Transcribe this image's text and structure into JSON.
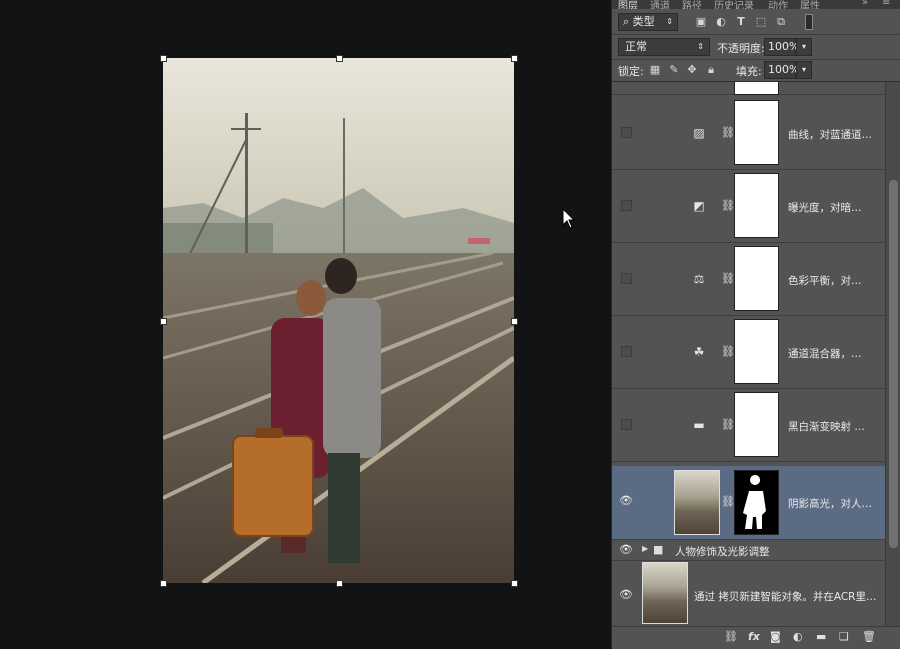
{
  "tabs": [
    "图层",
    "通道",
    "路径",
    "历史记录",
    "动作",
    "属性"
  ],
  "filter": {
    "label": "类型",
    "icons": [
      "image-filter-icon",
      "adjustment-filter-icon",
      "type-filter-icon",
      "shape-filter-icon",
      "smart-object-filter-icon"
    ]
  },
  "blend": {
    "mode": "正常",
    "opacity_label": "不透明度:",
    "opacity_value": "100%"
  },
  "lock": {
    "label": "锁定:",
    "fill_label": "填充:",
    "fill_value": "100%"
  },
  "layers": [
    {
      "name": "曲线，对蓝通道…",
      "icon": "curves-icon",
      "glyph": "▨"
    },
    {
      "name": "曝光度，对暗…",
      "icon": "exposure-icon",
      "glyph": "◩"
    },
    {
      "name": "色彩平衡，对…",
      "icon": "color-balance-icon",
      "glyph": "⚖"
    },
    {
      "name": "通道混合器，…",
      "icon": "channel-mixer-icon",
      "glyph": "☘"
    },
    {
      "name": "黑白渐变映射 …",
      "icon": "gradient-map-icon",
      "glyph": "▬"
    },
    {
      "name": "阴影高光，对人…",
      "icon": "smart-object-icon",
      "glyph": ""
    }
  ],
  "group": {
    "name": "人物修饰及光影调整"
  },
  "base_layer": {
    "name": "通过 拷贝新建智能对象。并在ACR里…"
  }
}
